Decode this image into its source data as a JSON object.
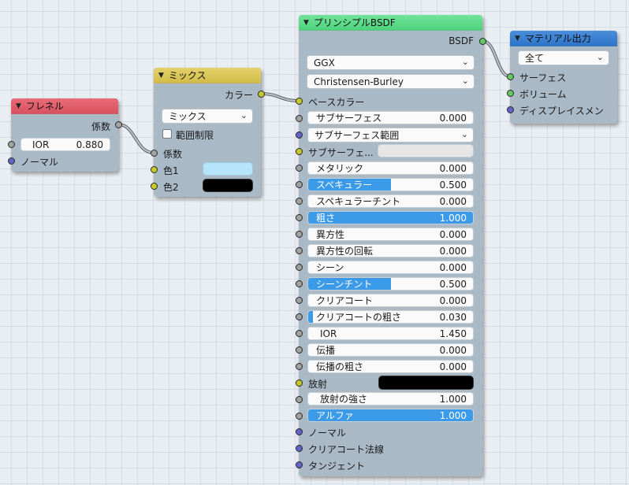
{
  "fresnel": {
    "title": "フレネル",
    "output_label": "係数",
    "ior_label": "IOR",
    "ior_value": "0.880",
    "normal_label": "ノーマル"
  },
  "mix": {
    "title": "ミックス",
    "output_label": "カラー",
    "blend_mode": "ミックス",
    "clamp_label": "範囲制限",
    "fac_label": "係数",
    "color1_label": "色1",
    "color2_label": "色2",
    "color1": "#b5e4fb",
    "color2": "#000000"
  },
  "bsdf": {
    "title": "プリンシプルBSDF",
    "output_label": "BSDF",
    "distribution": "GGX",
    "subsurface_method": "Christensen-Burley",
    "base_color_label": "ベースカラー",
    "subsurface_label": "サブサーフェス",
    "subsurface_value": "0.000",
    "subsurface_radius_label": "サブサーフェス範囲",
    "subsurface_color_label": "サブサーフェ...",
    "metallic_label": "メタリック",
    "metallic_value": "0.000",
    "specular_label": "スペキュラー",
    "specular_value": "0.500",
    "specular_tint_label": "スペキュラーチント",
    "specular_tint_value": "0.000",
    "roughness_label": "粗さ",
    "roughness_value": "1.000",
    "anisotropic_label": "異方性",
    "anisotropic_value": "0.000",
    "anisotropic_rotation_label": "異方性の回転",
    "anisotropic_rotation_value": "0.000",
    "sheen_label": "シーン",
    "sheen_value": "0.000",
    "sheen_tint_label": "シーンチント",
    "sheen_tint_value": "0.500",
    "clearcoat_label": "クリアコート",
    "clearcoat_value": "0.000",
    "clearcoat_roughness_label": "クリアコートの粗さ",
    "clearcoat_roughness_value": "0.030",
    "ior_label": "IOR",
    "ior_value": "1.450",
    "transmission_label": "伝播",
    "transmission_value": "0.000",
    "transmission_roughness_label": "伝播の粗さ",
    "transmission_roughness_value": "0.000",
    "emission_label": "放射",
    "emission_strength_label": "放射の強さ",
    "emission_strength_value": "1.000",
    "alpha_label": "アルファ",
    "alpha_value": "1.000",
    "normal_label": "ノーマル",
    "clearcoat_normal_label": "クリアコート法線",
    "tangent_label": "タンジェント"
  },
  "output": {
    "title": "マテリアル出力",
    "target": "全て",
    "surface_label": "サーフェス",
    "volume_label": "ボリューム",
    "displacement_label": "ディスプレイスメン"
  },
  "colors": {
    "slider_fill": "#3c9be8",
    "header_fresnel": "#d8525f",
    "header_mix": "#d2bc4a",
    "header_bsdf": "#4ed27c",
    "header_output": "#2f74c8"
  }
}
